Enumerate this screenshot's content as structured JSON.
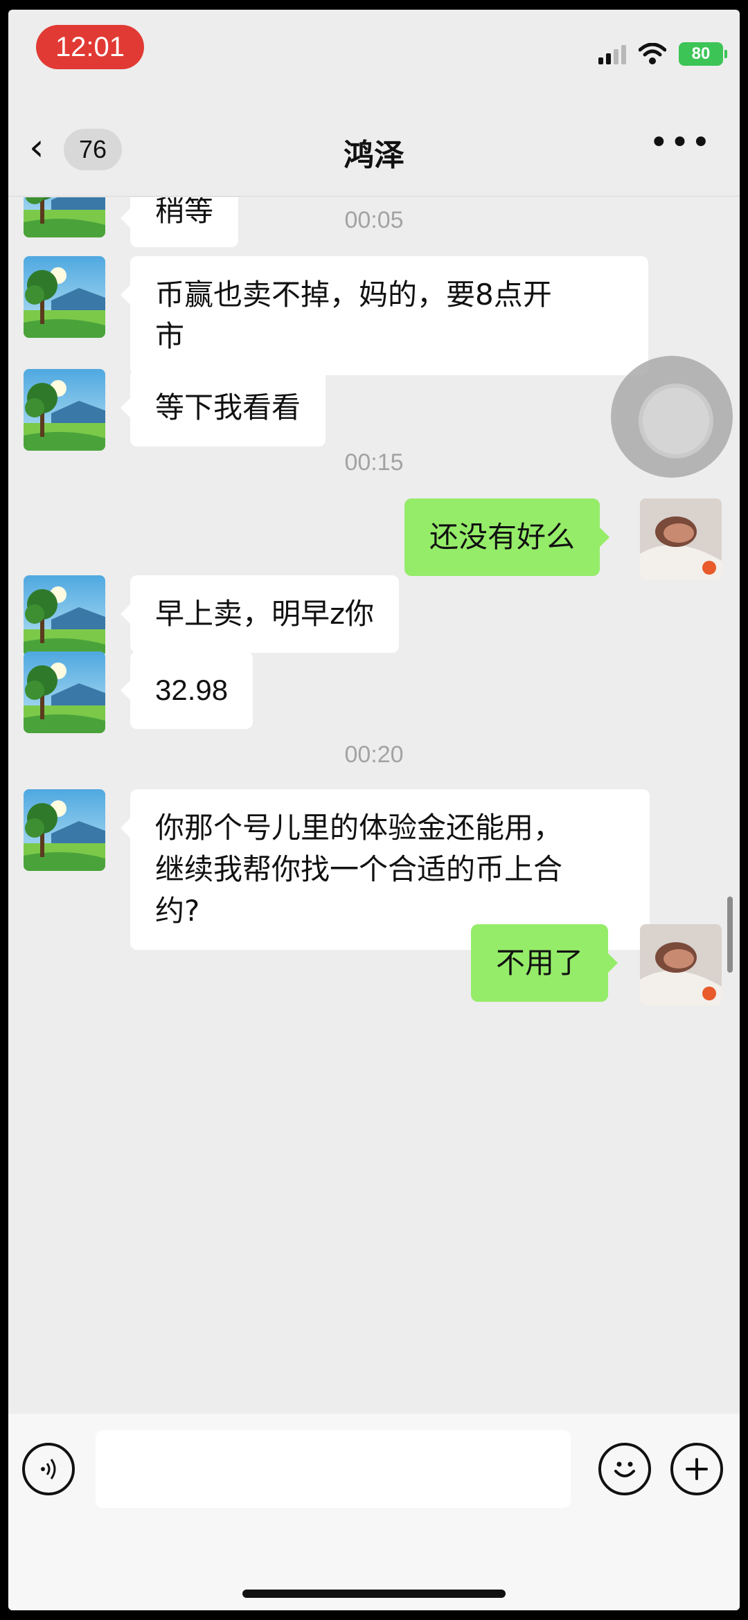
{
  "status_bar": {
    "time": "12:01",
    "battery": "80"
  },
  "nav": {
    "back_count": "76",
    "title": "鸿泽"
  },
  "messages": [
    {
      "id": "m0",
      "side": "left",
      "text": "稍等"
    },
    {
      "id": "t1",
      "type": "time",
      "text": "00:05"
    },
    {
      "id": "m1",
      "side": "left",
      "text": "币赢也卖不掉，妈的，要8点开\n市"
    },
    {
      "id": "m2",
      "side": "left",
      "text": "等下我看看"
    },
    {
      "id": "t2",
      "type": "time",
      "text": "00:15"
    },
    {
      "id": "m3",
      "side": "right",
      "text": "还没有好么"
    },
    {
      "id": "m4",
      "side": "left",
      "text": "早上卖，明早z你"
    },
    {
      "id": "m5",
      "side": "left",
      "text": "32.98"
    },
    {
      "id": "t3",
      "type": "time",
      "text": "00:20"
    },
    {
      "id": "m6",
      "side": "left",
      "text": "你那个号儿里的体验金还能用，\n继续我帮你找一个合适的币上合\n约?"
    },
    {
      "id": "m7",
      "side": "right",
      "text": "不用了"
    }
  ],
  "colors": {
    "accent": "#95ec69",
    "status_time_bg": "#e13a34",
    "battery": "#3cc456"
  },
  "icons": [
    "voice-icon",
    "emoji-icon",
    "plus-icon",
    "back-chevron-icon",
    "more-icon",
    "signal-icon",
    "wifi-icon",
    "battery-icon"
  ]
}
